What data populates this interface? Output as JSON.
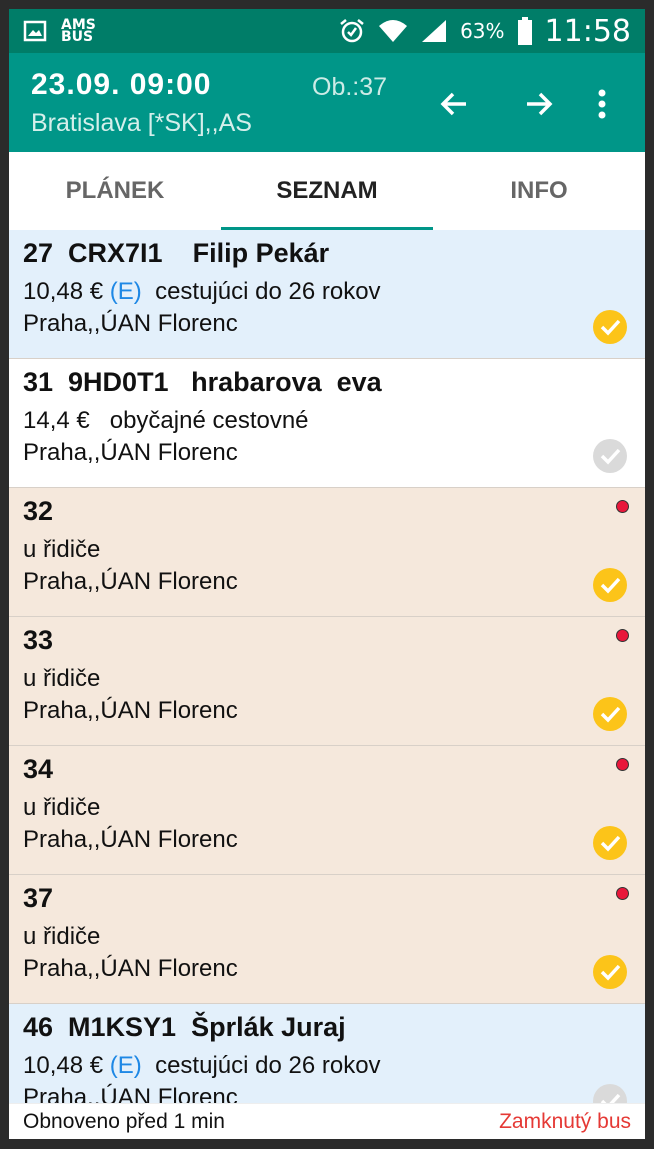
{
  "status_bar": {
    "battery": "63%",
    "time": "11:58",
    "icons": [
      "image-icon",
      "bus-logo-icon",
      "alarm-icon",
      "wifi-icon",
      "signal-icon",
      "battery-icon"
    ]
  },
  "app_bar": {
    "date_time": "23.09. 09:00",
    "route": "Bratislava [*SK],,AS",
    "ob": "Ob.:37"
  },
  "tabs": [
    {
      "label": "PLÁNEK",
      "active": false
    },
    {
      "label": "SEZNAM",
      "active": true
    },
    {
      "label": "INFO",
      "active": false
    }
  ],
  "rows": [
    {
      "title": "27  CRX7I1    Filip Pekár",
      "price": "10,48 € ",
      "badge": "(E)",
      "fare": "  cestujúci do 26 rokov",
      "stop": "Praha,,ÚAN Florenc",
      "check": "yellow",
      "dot": false,
      "bg": "blue"
    },
    {
      "title": "31  9HD0T1   hrabarova  eva",
      "price": "14,4 €   obyčajné cestovné",
      "badge": "",
      "fare": "",
      "stop": "Praha,,ÚAN Florenc",
      "check": "gray",
      "dot": false,
      "bg": "white"
    },
    {
      "title": "32",
      "price": "u řidiče",
      "badge": "",
      "fare": "",
      "stop": "Praha,,ÚAN Florenc",
      "check": "yellow",
      "dot": true,
      "bg": "beige"
    },
    {
      "title": "33",
      "price": "u řidiče",
      "badge": "",
      "fare": "",
      "stop": "Praha,,ÚAN Florenc",
      "check": "yellow",
      "dot": true,
      "bg": "beige"
    },
    {
      "title": "34",
      "price": "u řidiče",
      "badge": "",
      "fare": "",
      "stop": "Praha,,ÚAN Florenc",
      "check": "yellow",
      "dot": true,
      "bg": "beige"
    },
    {
      "title": "37",
      "price": "u řidiče",
      "badge": "",
      "fare": "",
      "stop": "Praha,,ÚAN Florenc",
      "check": "yellow",
      "dot": true,
      "bg": "beige"
    },
    {
      "title": "46  M1KSY1  Šprlák Juraj",
      "price": "10,48 € ",
      "badge": "(E)",
      "fare": "  cestujúci do 26 rokov",
      "stop": "Praha,,ÚAN Florenc",
      "check": "gray",
      "dot": false,
      "bg": "blue"
    }
  ],
  "footer": {
    "updated": "Obnoveno před 1 min",
    "lock_status": "Zamknutý bus"
  },
  "colors": {
    "status_bar": "#007d68",
    "app_bar": "#009688",
    "check_yellow": "#fcc419",
    "check_gray": "#dadada",
    "dot_red": "#e8173b",
    "lock_red": "#e53935"
  }
}
